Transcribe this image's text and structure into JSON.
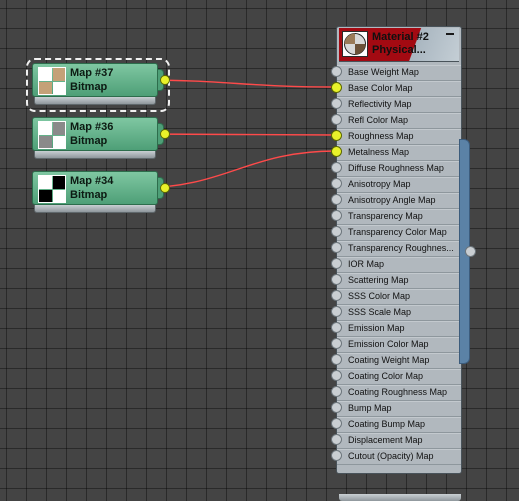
{
  "map_nodes": [
    {
      "title": "Map #37",
      "type": "Bitmap",
      "selected": true,
      "thumbnail": "tan-white-checker",
      "colors": [
        "#ffffff",
        "#c4a178"
      ]
    },
    {
      "title": "Map #36",
      "type": "Bitmap",
      "selected": false,
      "thumbnail": "gray-white-checker",
      "colors": [
        "#ffffff",
        "#8a8a8a"
      ]
    },
    {
      "title": "Map #34",
      "type": "Bitmap",
      "selected": false,
      "thumbnail": "black-white-checker",
      "colors": [
        "#ffffff",
        "#000000"
      ]
    }
  ],
  "material": {
    "title": "Material #2",
    "subtitle": "Physical...",
    "header_color": "#a30a12",
    "slots": [
      "Base Weight Map",
      "Base Color Map",
      "Reflectivity Map",
      "Refl Color Map",
      "Roughness Map",
      "Metalness Map",
      "Diffuse Roughness Map",
      "Anisotropy Map",
      "Anisotropy Angle Map",
      "Transparency Map",
      "Transparency Color Map",
      "Transparency Roughnes...",
      "IOR Map",
      "Scattering Map",
      "SSS Color Map",
      "SSS Scale Map",
      "Emission Map",
      "Emission Color Map",
      "Coating Weight Map",
      "Coating Color Map",
      "Coating Roughness Map",
      "Bump Map",
      "Coating Bump Map",
      "Displacement Map",
      "Cutout (Opacity) Map"
    ]
  },
  "connections": [
    {
      "from": "Map #37",
      "to": "Base Color Map"
    },
    {
      "from": "Map #36",
      "to": "Roughness Map"
    },
    {
      "from": "Map #34",
      "to": "Metalness Map"
    }
  ],
  "colors": {
    "wire": "#ff4a4a",
    "connected_port": "#e9f22a",
    "map_node": "#5fb087",
    "output_bar": "#5b82a6"
  }
}
